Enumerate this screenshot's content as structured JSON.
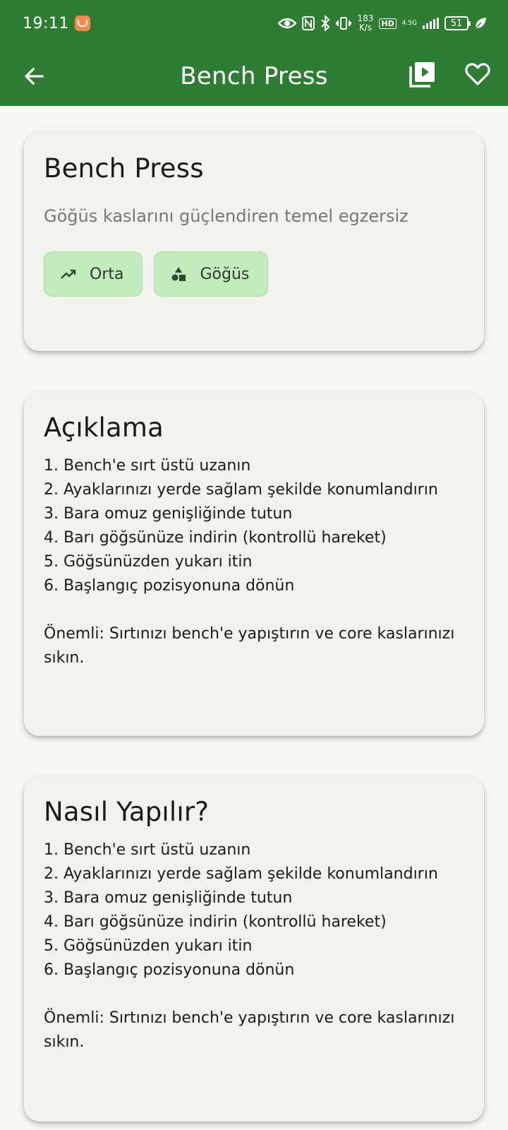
{
  "status": {
    "time": "19:11",
    "speed_value": "183",
    "speed_unit": "K/s",
    "hd": "HD",
    "network": "4.5G",
    "battery": "51"
  },
  "appbar": {
    "title": "Bench Press"
  },
  "exercise": {
    "name": "Bench Press",
    "description": "Göğüs kaslarını güçlendiren temel egzersiz",
    "chips": [
      {
        "label": "Orta",
        "icon": "trending-up-icon"
      },
      {
        "label": "Göğüs",
        "icon": "category-shapes-icon"
      }
    ]
  },
  "sections": [
    {
      "title": "Açıklama",
      "body": "1. Bench'e sırt üstü uzanın\n2. Ayaklarınızı yerde sağlam şekilde konumlandırın\n3. Bara omuz genişliğinde tutun\n4. Barı göğsünüze indirin (kontrollü hareket)\n5. Göğsünüzden yukarı itin\n6. Başlangıç pozisyonuna dönün\n\nÖnemli: Sırtınızı bench'e yapıştırın ve core kaslarınızı sıkın."
    },
    {
      "title": "Nasıl Yapılır?",
      "body": "1. Bench'e sırt üstü uzanın\n2. Ayaklarınızı yerde sağlam şekilde konumlandırın\n3. Bara omuz genişliğinde tutun\n4. Barı göğsünüze indirin (kontrollü hareket)\n5. Göğsünüzden yukarı itin\n6. Başlangıç pozisyonuna dönün\n\nÖnemli: Sırtınızı bench'e yapıştırın ve core kaslarınızı sıkın."
    }
  ],
  "colors": {
    "primary": "#2e7d32",
    "background": "#f6f8f1",
    "card": "#f1f3ec",
    "chip": "#c3ebbd"
  }
}
